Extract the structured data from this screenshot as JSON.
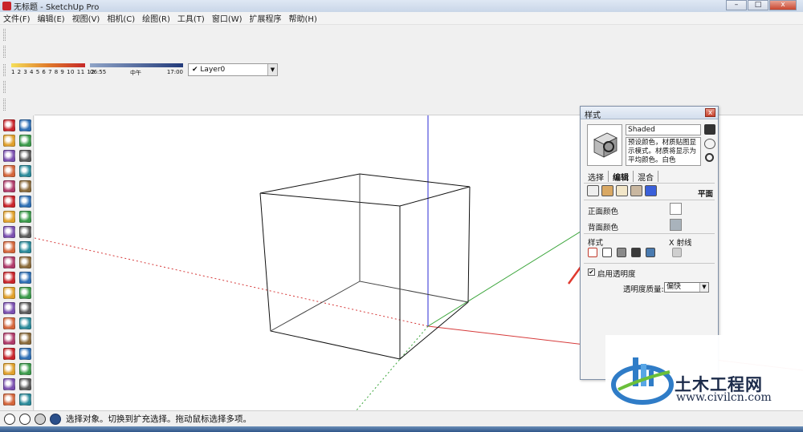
{
  "window": {
    "title": "无标题 - SketchUp Pro",
    "controls": [
      "–",
      "□",
      "x"
    ]
  },
  "menu": [
    "文件(F)",
    "编辑(E)",
    "视图(V)",
    "相机(C)",
    "绘图(R)",
    "工具(T)",
    "窗口(W)",
    "扩展程序",
    "帮助(H)"
  ],
  "toolbar": {
    "shadow_months": "1 2 3 4 5 6 7 8 9 10 11 12",
    "time_start": "06:55",
    "time_mid": "中午",
    "time_end": "17:00",
    "layer_check": "✔",
    "layer_name": "Layer0",
    "layer_arrow": "▼"
  },
  "styles_dialog": {
    "title": "样式",
    "close": "x",
    "style_name": "Shaded",
    "description": "预设颜色，材质贴图显示模式。材质将显示为平均颜色。白色",
    "tabs": [
      "选择",
      "编辑",
      "混合"
    ],
    "active_tab": "编辑",
    "face_section_label": "平面",
    "front_color_label": "正面颜色",
    "front_color": "#ffffff",
    "back_color_label": "背面颜色",
    "back_color": "#a9b3bc",
    "style_label": "样式",
    "xray_label": "X 射线",
    "transparency_enabled_label": "启用透明度",
    "transparency_checked": "✔",
    "transparency_quality_label": "透明度质量:",
    "transparency_quality_value": "偏快",
    "select_arrow": "▼"
  },
  "status": {
    "text": "选择对象。切换到扩充选择。拖动鼠标选择多项。"
  },
  "watermark": {
    "brand": "土木工程网",
    "url": "www.civilcn.com"
  },
  "colors": {
    "red_axis": "#d63a3a",
    "green_axis": "#3aa53a",
    "blue_axis": "#2b2bd6",
    "annotation_arrow": "#e0392e",
    "accent_red": "#c9242b"
  }
}
